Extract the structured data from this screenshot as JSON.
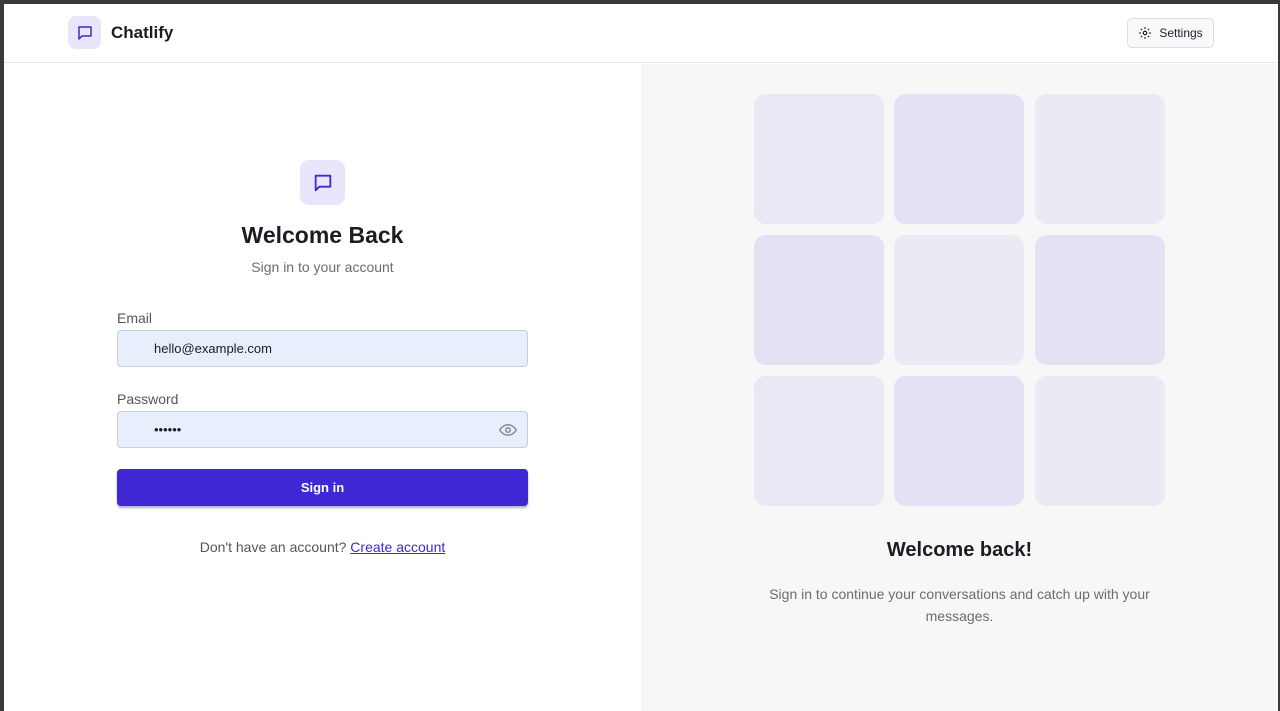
{
  "header": {
    "app_name": "Chatlify",
    "settings_label": "Settings"
  },
  "login": {
    "title": "Welcome Back",
    "subtitle": "Sign in to your account",
    "email_label": "Email",
    "email_value": "hello@example.com",
    "password_label": "Password",
    "password_value": "••••••",
    "signin_label": "Sign in",
    "no_account_text": "Don't have an account?",
    "create_account_label": "Create account"
  },
  "promo": {
    "title": "Welcome back!",
    "subtitle": "Sign in to continue your conversations and catch up with your messages."
  },
  "colors": {
    "accent": "#3f28d4",
    "logo_bg": "#e9e6fb",
    "input_bg": "#e8effc",
    "right_pane_bg": "#f7f7f7"
  },
  "icons": {
    "brand": "chat-bubble-icon",
    "settings": "gear-icon",
    "password_toggle": "eye-icon"
  }
}
